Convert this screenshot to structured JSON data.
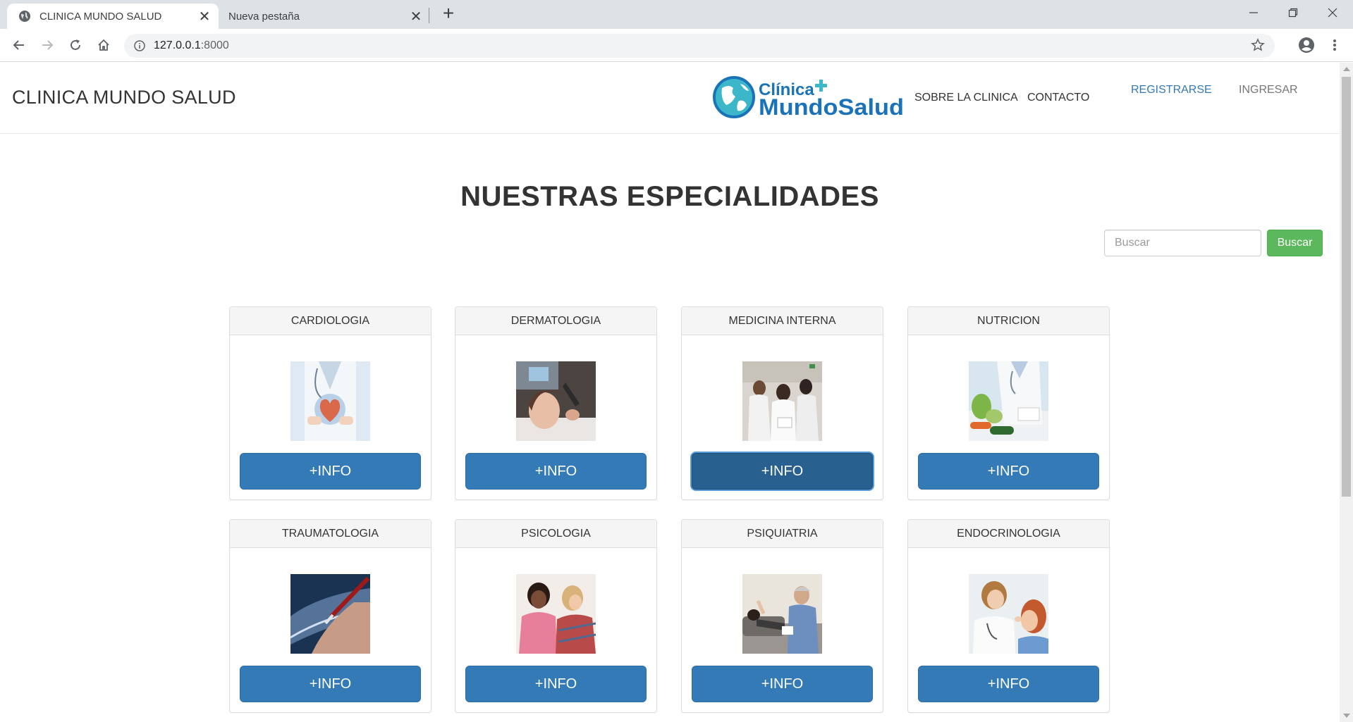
{
  "browser": {
    "tabs": [
      {
        "title": "CLINICA MUNDO SALUD",
        "active": true
      },
      {
        "title": "Nueva pestaña",
        "active": false
      }
    ],
    "url_host": "127.0.0.1",
    "url_port": ":8000"
  },
  "navbar": {
    "brand": "CLINICA MUNDO SALUD",
    "logo_line1": "Clínica",
    "logo_line2": "MundoSalud",
    "links": {
      "about": "SOBRE LA CLINICA",
      "contact": "CONTACTO",
      "register": "REGISTRARSE",
      "login": "INGRESAR"
    }
  },
  "main": {
    "heading": "NUESTRAS ESPECIALIDADES",
    "search": {
      "placeholder": "Buscar",
      "button": "Buscar"
    },
    "specialties": [
      {
        "name": "CARDIOLOGIA",
        "button": "+INFO"
      },
      {
        "name": "DERMATOLOGIA",
        "button": "+INFO"
      },
      {
        "name": "MEDICINA INTERNA",
        "button": "+INFO"
      },
      {
        "name": "NUTRICION",
        "button": "+INFO"
      },
      {
        "name": "TRAUMATOLOGIA",
        "button": "+INFO"
      },
      {
        "name": "PSICOLOGIA",
        "button": "+INFO"
      },
      {
        "name": "PSIQUIATRIA",
        "button": "+INFO"
      },
      {
        "name": "ENDOCRINOLOGIA",
        "button": "+INFO"
      }
    ]
  },
  "colors": {
    "primary_button": "#337ab7",
    "success_button": "#5cb85c",
    "link": "#337ab7",
    "logo_blue": "#1a73b8",
    "logo_teal": "#3bb7c9"
  }
}
